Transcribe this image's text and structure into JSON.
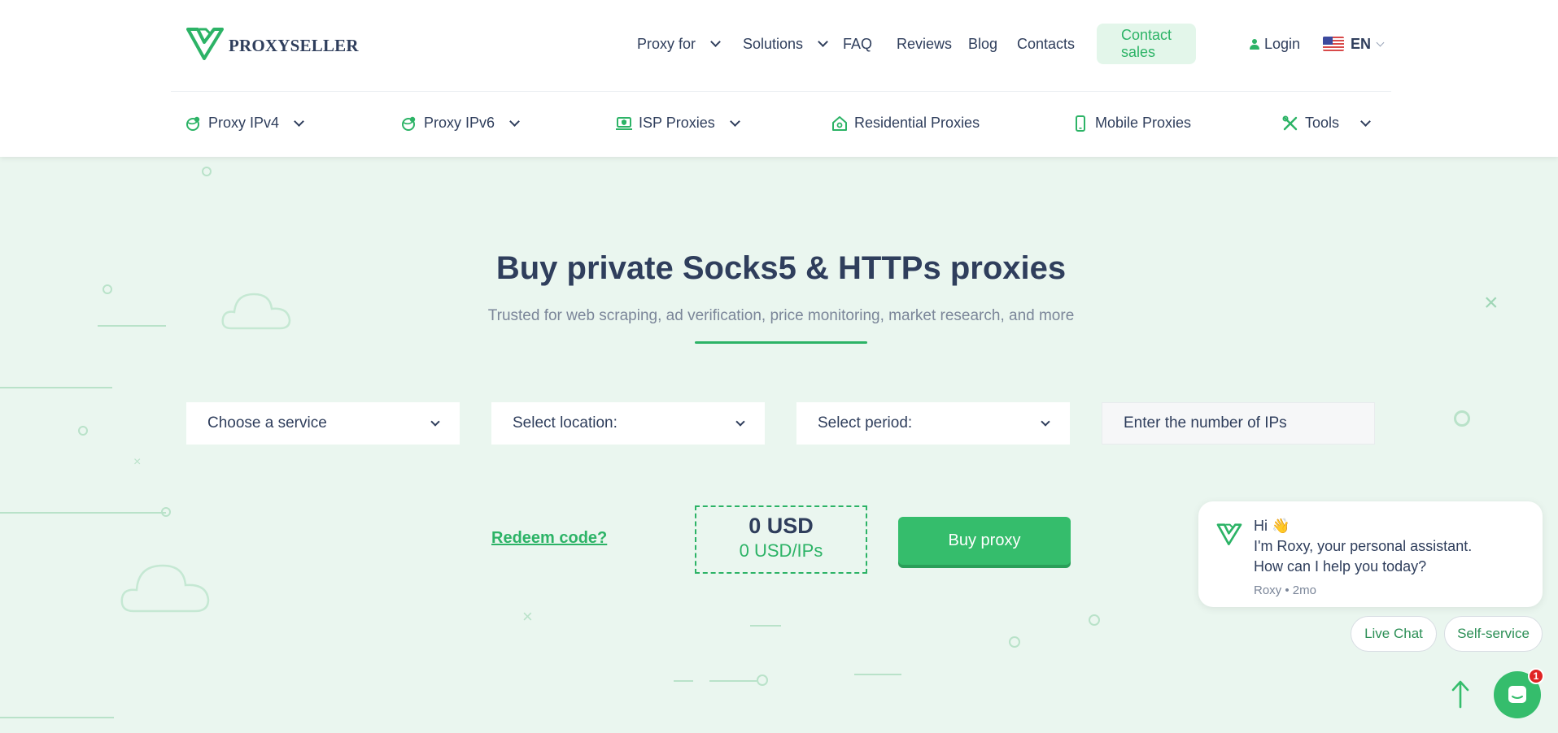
{
  "brand": {
    "name": "PROXYSELLER"
  },
  "top_nav": {
    "proxy_for": "Proxy for",
    "solutions": "Solutions",
    "faq": "FAQ",
    "reviews": "Reviews",
    "blog": "Blog",
    "contacts": "Contacts",
    "contact_sales": "Contact sales",
    "login": "Login",
    "language": "EN"
  },
  "sub_nav": {
    "items": [
      {
        "label": "Proxy IPv4",
        "icon": "globe-pin-icon",
        "dropdown": true
      },
      {
        "label": "Proxy IPv6",
        "icon": "globe-pin-icon",
        "dropdown": true
      },
      {
        "label": "ISP Proxies",
        "icon": "laptop-shield-icon",
        "dropdown": true
      },
      {
        "label": "Residential Proxies",
        "icon": "house-icon",
        "dropdown": false
      },
      {
        "label": "Mobile Proxies",
        "icon": "phone-icon",
        "dropdown": false
      },
      {
        "label": "Tools",
        "icon": "tools-icon",
        "dropdown": true
      }
    ]
  },
  "hero": {
    "title": "Buy private Socks5 & HTTPs proxies",
    "subtitle": "Trusted for web scraping, ad verification, price monitoring, market research, and more"
  },
  "order_form": {
    "service_select": "Choose a service",
    "location_select": "Select location:",
    "period_select": "Select period:",
    "ip_count_placeholder": "Enter the number of IPs",
    "redeem_label": "Redeem code?",
    "total_price": "0 USD",
    "per_ip_price": "0 USD/IPs",
    "buy_label": "Buy proxy"
  },
  "chat": {
    "greeting": "Hi 👋",
    "line1": "I'm Roxy, your personal assistant.",
    "line2": "How can I help you today?",
    "meta": "Roxy • 2mo",
    "live_chat": "Live Chat",
    "self_service": "Self-service",
    "unread_count": "1"
  },
  "colors": {
    "accent": "#35bd6c",
    "text": "#2f3e5c",
    "background": "#eaf6ef"
  }
}
